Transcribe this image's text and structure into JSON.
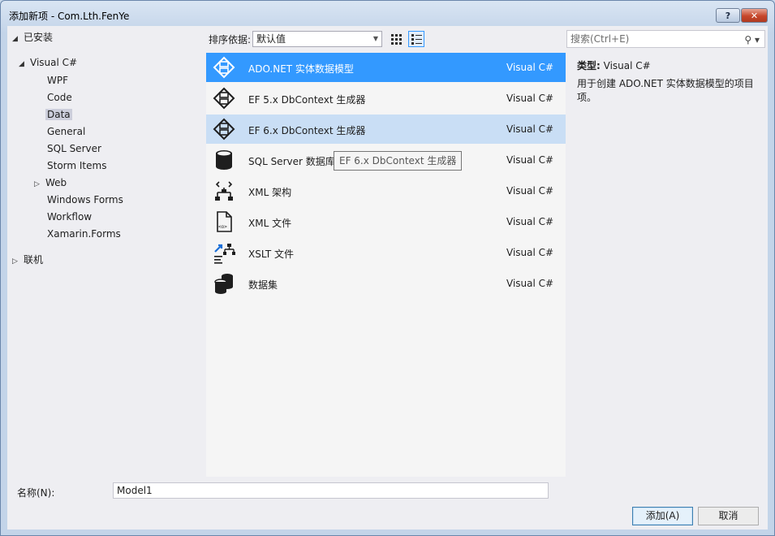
{
  "window": {
    "title": "添加新项 - Com.Lth.FenYe",
    "help": "?",
    "close": "✕"
  },
  "tree": {
    "installed": "已安装",
    "visual_csharp": "Visual C#",
    "items": [
      "WPF",
      "Code",
      "Data",
      "General",
      "SQL Server",
      "Storm Items",
      "Web",
      "Windows Forms",
      "Workflow",
      "Xamarin.Forms"
    ],
    "online": "联机"
  },
  "toolbar": {
    "sort_label": "排序依据:",
    "sort_value": "默认值"
  },
  "search": {
    "placeholder": "搜索(Ctrl+E)"
  },
  "templates": [
    {
      "name": "ADO.NET 实体数据模型",
      "lang": "Visual C#",
      "icon": "ado-net-icon"
    },
    {
      "name": "EF 5.x DbContext 生成器",
      "lang": "Visual C#",
      "icon": "ef-generator-icon"
    },
    {
      "name": "EF 6.x DbContext 生成器",
      "lang": "Visual C#",
      "icon": "ef-generator-icon"
    },
    {
      "name": "SQL Server 数据库",
      "lang": "Visual C#",
      "icon": "database-icon"
    },
    {
      "name": "XML 架构",
      "lang": "Visual C#",
      "icon": "xml-schema-icon"
    },
    {
      "name": "XML 文件",
      "lang": "Visual C#",
      "icon": "xml-file-icon"
    },
    {
      "name": "XSLT 文件",
      "lang": "Visual C#",
      "icon": "xslt-file-icon"
    },
    {
      "name": "数据集",
      "lang": "Visual C#",
      "icon": "dataset-icon"
    }
  ],
  "tooltip": "EF 6.x DbContext 生成器",
  "details": {
    "type_label": "类型:",
    "type_value": "Visual C#",
    "description": "用于创建 ADO.NET 实体数据模型的项目项。"
  },
  "form": {
    "name_label": "名称(N):",
    "name_value": "Model1"
  },
  "buttons": {
    "add": "添加(A)",
    "cancel": "取消"
  },
  "colors": {
    "selected": "#3399ff",
    "hover": "#c9def5",
    "background": "#eeeef2"
  }
}
